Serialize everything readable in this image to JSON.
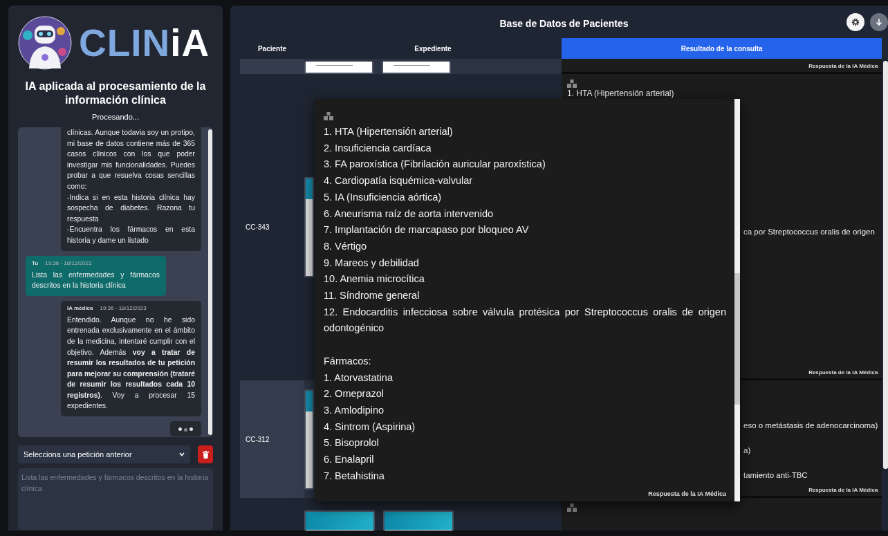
{
  "sidebar": {
    "logo_main": "CLIN",
    "logo_accent": "iA",
    "title": "IA aplicada al procesamiento de la información clínica",
    "status": "Procesando...",
    "chat": {
      "messages": [
        {
          "kind": "ai",
          "text": "clínicas. Aunque todavia soy un protipo, mi base de datos contiene más de 365 casos clínicos con los que poder investigar mis funcionalidades. Puedes probar a que resuelva cosas sencillas como:\n-Indica si en esta historia clínica hay sospecha de diabetes. Razona tu respuesta\n-Encuentra los fármacos en esta historia y dame un listado"
        },
        {
          "kind": "user",
          "sender": "Tu",
          "time": "19:36 - 18/12/2023",
          "text": "Lista las enfermedades y fármacos descritos en la historia clínica"
        },
        {
          "kind": "ai",
          "sender": "IA médica",
          "time": "19:36 - 18/12/2023",
          "text": "Entendido. Aunque no he sido entrenada exclusivamente en el ámbito de la medicina, intentaré cumplir con el objetivo. Además **voy a tratar de resumir los resultados de tu petición para mejorar su comprensión (trataré de resumir los resultados cada 10 registros)**. Voy a procesar 15 expedientes."
        }
      ],
      "typing": true
    },
    "history_select": {
      "value": "Selecciona una petición anterior"
    },
    "prompt": {
      "placeholder": "Lista las enfermedades y fármacos descritos en la historia clínica"
    }
  },
  "main": {
    "title": "Base de Datos de Pacientes",
    "table": {
      "columns": [
        {
          "label": "Paciente",
          "selected": false
        },
        {
          "label": "Expediente",
          "selected": false
        },
        {
          "label": "Resultado de la consulta",
          "selected": true
        }
      ],
      "rows": [
        {
          "documents": [
            {
              "kind": "page"
            },
            {
              "kind": "page"
            }
          ],
          "result_lines": [],
          "footer": "Respuesta de la IA Médica"
        },
        {
          "patient": "CC-343",
          "documents": [
            {
              "kind": "edge"
            }
          ],
          "icon": true,
          "result_lines": [
            {
              "kind": "full",
              "text": "1. HTA (Hipertensión arterial)"
            },
            {
              "kind": "cut",
              "text": "ca por Streptococcus oralis de origen"
            }
          ],
          "footer": "Respuesta de la IA Médica"
        },
        {
          "patient": "CC-312",
          "documents": [
            {
              "kind": "edge"
            }
          ],
          "result_lines": [
            {
              "kind": "cut",
              "text": "eso o metástasis de adenocarcinoma)"
            },
            {
              "kind": "cut",
              "text": "a)"
            },
            {
              "kind": "cut",
              "text": "tamiento anti-TBC"
            }
          ],
          "footer": "Respuesta de la IA Médica"
        },
        {
          "documents": [
            {
              "kind": "cover"
            },
            {
              "kind": "cover"
            }
          ],
          "icon": true,
          "result_lines": []
        }
      ]
    },
    "popup": {
      "diseases": [
        "1. HTA (Hipertensión arterial)",
        "2. Insuficiencia cardíaca",
        "3. FA paroxística (Fibrilación auricular paroxística)",
        "4. Cardiopatía isquémica-valvular",
        "5. IA (Insuficiencia aórtica)",
        "6. Aneurisma raíz de aorta intervenido",
        "7. Implantación de marcapaso por bloqueo AV",
        "8. Vértigo",
        "9. Mareos y debilidad",
        "10. Anemia microcítica",
        "11. Síndrome general",
        "12. Endocarditis infecciosa sobre válvula protésica por Streptococcus oralis de origen odontogénico"
      ],
      "drugs_heading": "Fármacos:",
      "drugs": [
        "1. Atorvastatina",
        "2. Omeprazol",
        "3. Amlodipino",
        "4. Sintrom (Aspirina)",
        "5. Bisoprolol",
        "6. Enalapril",
        "7. Betahistina"
      ],
      "footer": "Respuesta de la IA Médica"
    }
  }
}
